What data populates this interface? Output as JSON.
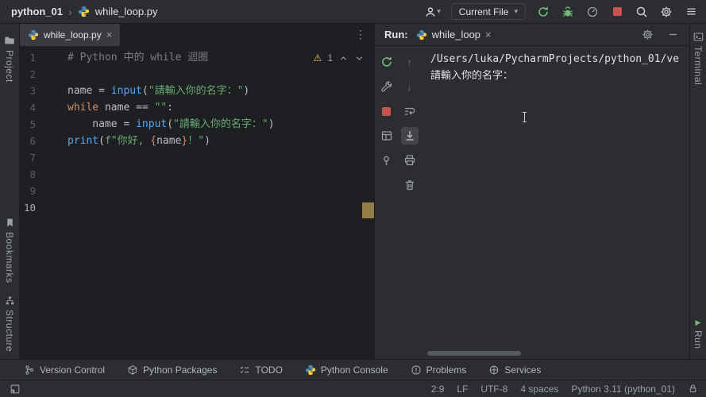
{
  "icons": {
    "chevron_right": "›",
    "dropdown_arrow": "▾",
    "more_vertical": "⋮",
    "warning": "⚠",
    "arrow_up": "↑",
    "arrow_down": "↓",
    "play": "▶",
    "close": "×"
  },
  "titlebar": {
    "project": "python_01",
    "file": "while_loop.py",
    "run_config": "Current File"
  },
  "left_stripe": {
    "project": "Project",
    "bookmarks": "Bookmarks",
    "structure": "Structure"
  },
  "right_stripe": {
    "terminal": "Terminal",
    "run": "Run"
  },
  "editor": {
    "tab_label": "while_loop.py",
    "warning_count": "1",
    "lines": [
      {
        "num": "1",
        "code": [
          [
            "c",
            "# Python 中的 while 迴圈"
          ]
        ]
      },
      {
        "num": "2",
        "code": []
      },
      {
        "num": "3",
        "code": [
          [
            "p",
            "name = "
          ],
          [
            "f",
            "input"
          ],
          [
            "p",
            "("
          ],
          [
            "s",
            "\"請輸入你的名字："
          ],
          [
            "s",
            "\""
          ],
          [
            "p",
            ")"
          ]
        ]
      },
      {
        "num": "4",
        "code": [
          [
            "k",
            "while "
          ],
          [
            "p",
            "name == "
          ],
          [
            "s",
            "\"\""
          ],
          [
            "p",
            ":"
          ]
        ]
      },
      {
        "num": "5",
        "code": [
          [
            "p",
            "    name = "
          ],
          [
            "f",
            "input"
          ],
          [
            "p",
            "("
          ],
          [
            "s",
            "\"請輸入你的名字："
          ],
          [
            "s",
            "\""
          ],
          [
            "p",
            ")"
          ]
        ]
      },
      {
        "num": "6",
        "code": [
          [
            "f",
            "print"
          ],
          [
            "p",
            "("
          ],
          [
            "s",
            "f\"你好, "
          ],
          [
            "b",
            "{"
          ],
          [
            "p",
            "name"
          ],
          [
            "b",
            "}"
          ],
          [
            "s",
            "！\""
          ],
          [
            "p",
            ")"
          ]
        ]
      },
      {
        "num": "7",
        "code": []
      },
      {
        "num": "8",
        "code": []
      },
      {
        "num": "9",
        "code": []
      },
      {
        "num": "10",
        "code": [],
        "current": true
      }
    ]
  },
  "run_panel": {
    "label": "Run:",
    "tab_label": "while_loop",
    "console_lines": [
      "/Users/luka/PycharmProjects/python_01/ve",
      "請輸入你的名字："
    ]
  },
  "tool_buttons": [
    {
      "label": "Version Control"
    },
    {
      "label": "Python Packages"
    },
    {
      "label": "TODO"
    },
    {
      "label": "Python Console"
    },
    {
      "label": "Problems"
    },
    {
      "label": "Services"
    }
  ],
  "statusbar": {
    "caret": "2:9",
    "line_separator": "LF",
    "encoding": "UTF-8",
    "indent": "4 spaces",
    "interpreter": "Python 3.11 (python_01)"
  },
  "colors": {
    "accent_green": "#73BD79",
    "stop_red": "#C75450",
    "warning_yellow": "#F2C55C",
    "string_green": "#6AAB73",
    "keyword_orange": "#CF8E6D",
    "function_blue": "#56A8F5",
    "comment_gray": "#7A7E85",
    "panel_bg": "#2B2D30",
    "editor_bg": "#1E1F22"
  }
}
